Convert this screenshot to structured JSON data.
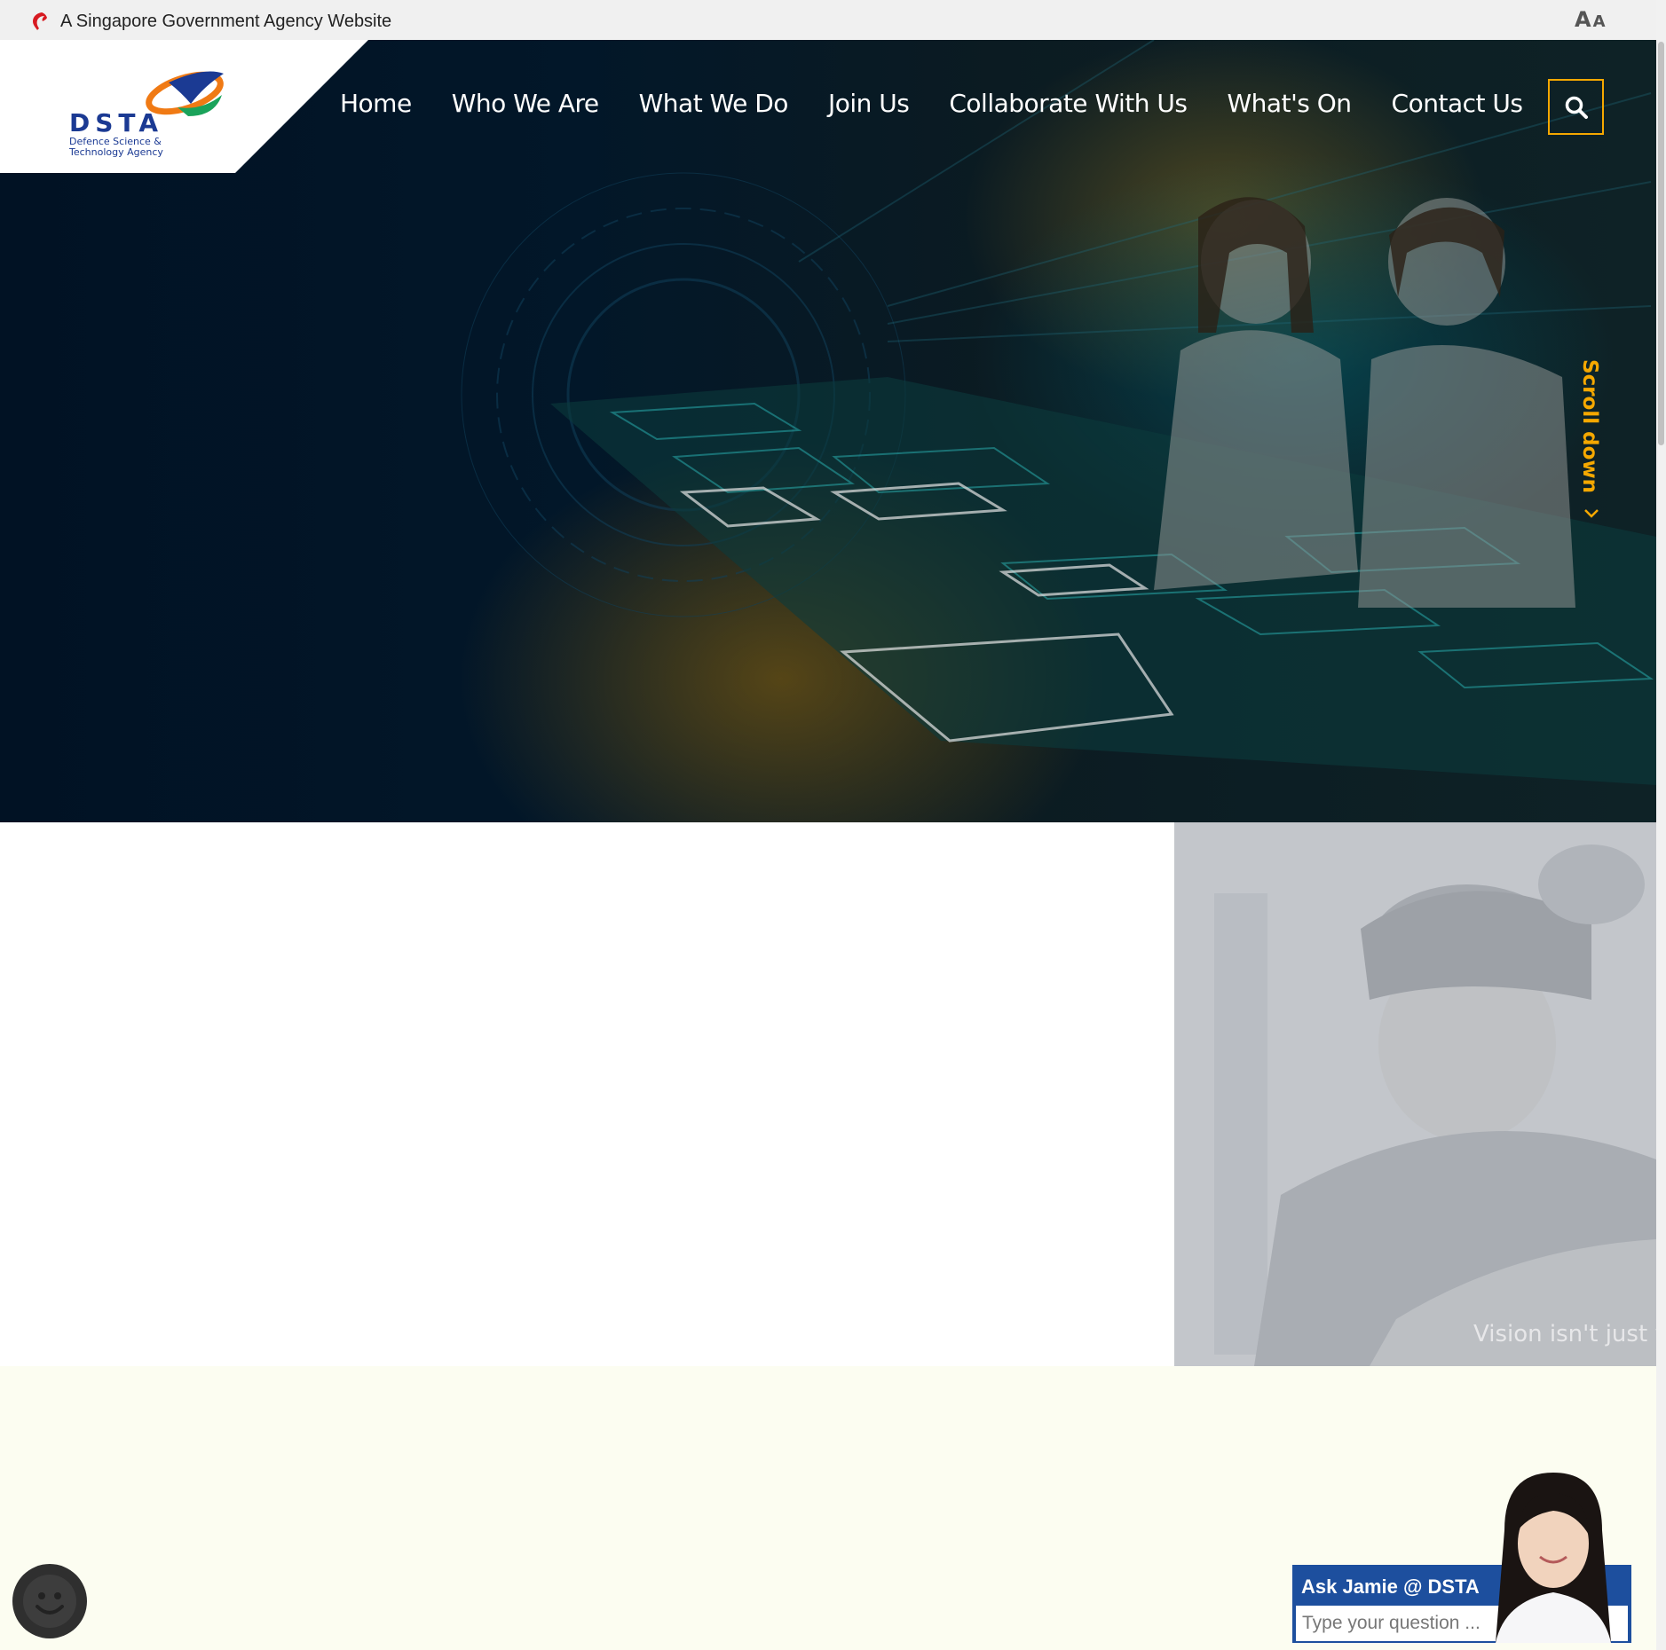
{
  "masthead": {
    "text": "A Singapore Government Agency Website",
    "font_size_big": "A",
    "font_size_small": "A"
  },
  "logo": {
    "name": "DSTA",
    "tagline_line1": "Defence Science &",
    "tagline_line2": "Technology Agency"
  },
  "nav": {
    "items": [
      {
        "label": "Home"
      },
      {
        "label": "Who We Are"
      },
      {
        "label": "What We Do"
      },
      {
        "label": "Join Us"
      },
      {
        "label": "Collaborate With Us"
      },
      {
        "label": "What's On"
      },
      {
        "label": "Contact Us"
      }
    ]
  },
  "hero": {
    "scroll_label": "Scroll down"
  },
  "carousel": {
    "caption": "Vision isn't just wh",
    "slide_count": 3
  },
  "chatbot": {
    "title": "Ask Jamie @ DSTA",
    "placeholder": "Type your question ..."
  },
  "colors": {
    "accent": "#f5a800",
    "nav_text": "#ffffff",
    "hero_bg": "#021729",
    "chat_blue": "#1d4f9e",
    "lower_bg": "#fcfdf1",
    "media_grey": "#c3c6cb"
  },
  "icons": {
    "masthead": "lion-head-icon",
    "search": "search-icon",
    "scroll": "chevron-down-icon",
    "feedback": "smiley-icon"
  }
}
